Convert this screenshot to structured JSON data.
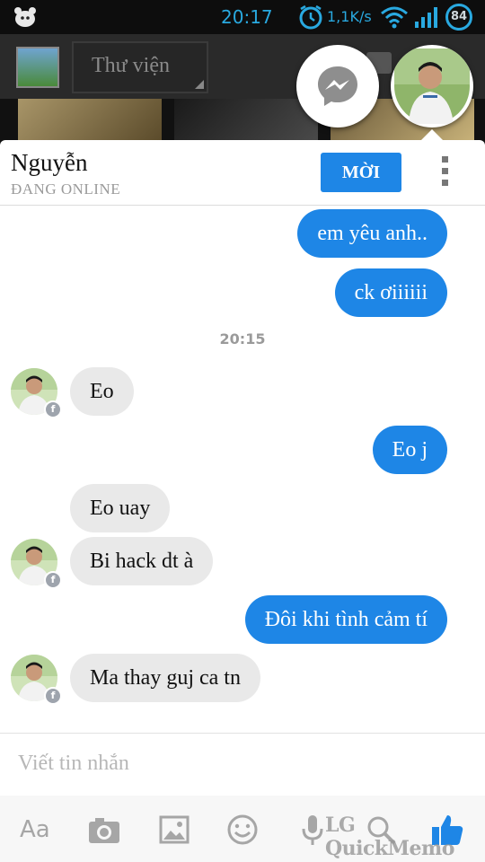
{
  "status_bar": {
    "time": "20:17",
    "network_speed": "1,1K/s",
    "battery": "84",
    "icons": [
      "app-notification-icon",
      "clock-icon",
      "wifi-icon",
      "signal-icon",
      "battery-icon"
    ]
  },
  "background_app": {
    "gallery_title": "Thư viện"
  },
  "chat": {
    "contact_name": "Nguyễn",
    "contact_status": "ĐANG ONLINE",
    "invite_label": "MỜI",
    "timestamp": "20:15",
    "messages": [
      {
        "direction": "sent",
        "text": "em yêu anh.."
      },
      {
        "direction": "sent",
        "text": "ck ơiiiiii"
      },
      {
        "direction": "received",
        "text": "Eo"
      },
      {
        "direction": "sent",
        "text": "Eo j"
      },
      {
        "direction": "received",
        "text": "Eo uay"
      },
      {
        "direction": "received",
        "text": "Bi hack dt à"
      },
      {
        "direction": "sent",
        "text": "Đôi khi tình cảm tí"
      },
      {
        "direction": "received",
        "text": "Ma thay guj ca tn"
      }
    ],
    "composer_placeholder": "Viết tin nhắn",
    "toolbar": {
      "aa_label": "Aa",
      "icons": [
        "text-format-icon",
        "camera-icon",
        "gallery-icon",
        "emoji-icon",
        "microphone-icon",
        "search-icon",
        "like-icon"
      ]
    }
  },
  "watermark": "LG QuickMemo",
  "colors": {
    "accent": "#1e86e6",
    "status_bar_text": "#29a9e0",
    "received_bubble": "#e9e9e9"
  }
}
